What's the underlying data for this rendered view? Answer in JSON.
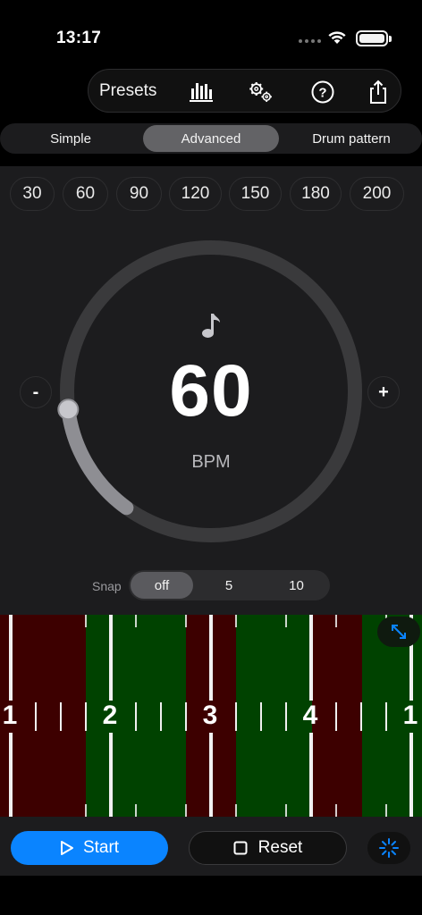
{
  "status_bar": {
    "time": "13:17"
  },
  "toolbar": {
    "presets_label": "Presets",
    "icons": [
      "equalizer-icon",
      "gears-icon",
      "help-icon",
      "share-icon"
    ]
  },
  "modes": {
    "items": [
      "Simple",
      "Advanced",
      "Drum pattern"
    ],
    "selected": "Advanced"
  },
  "bpm_presets": [
    "30",
    "60",
    "90",
    "120",
    "150",
    "180",
    "200"
  ],
  "tempo": {
    "value": "60",
    "unit": "BPM",
    "decrement_label": "-",
    "increment_label": "+",
    "note_icon": "music-note-icon",
    "dial_fraction": 0.13
  },
  "snap": {
    "label": "Snap",
    "options": [
      "off",
      "5",
      "10"
    ],
    "selected": "off"
  },
  "beat_ruler": {
    "beat_labels": [
      "1",
      "2",
      "3",
      "4",
      "1"
    ],
    "colors": {
      "red": "#3d0000",
      "green": "#004200"
    }
  },
  "controls": {
    "start_label": "Start",
    "reset_label": "Reset"
  },
  "colors": {
    "accent": "#0a84ff",
    "background": "#000000",
    "panel": "#1c1c1e"
  }
}
